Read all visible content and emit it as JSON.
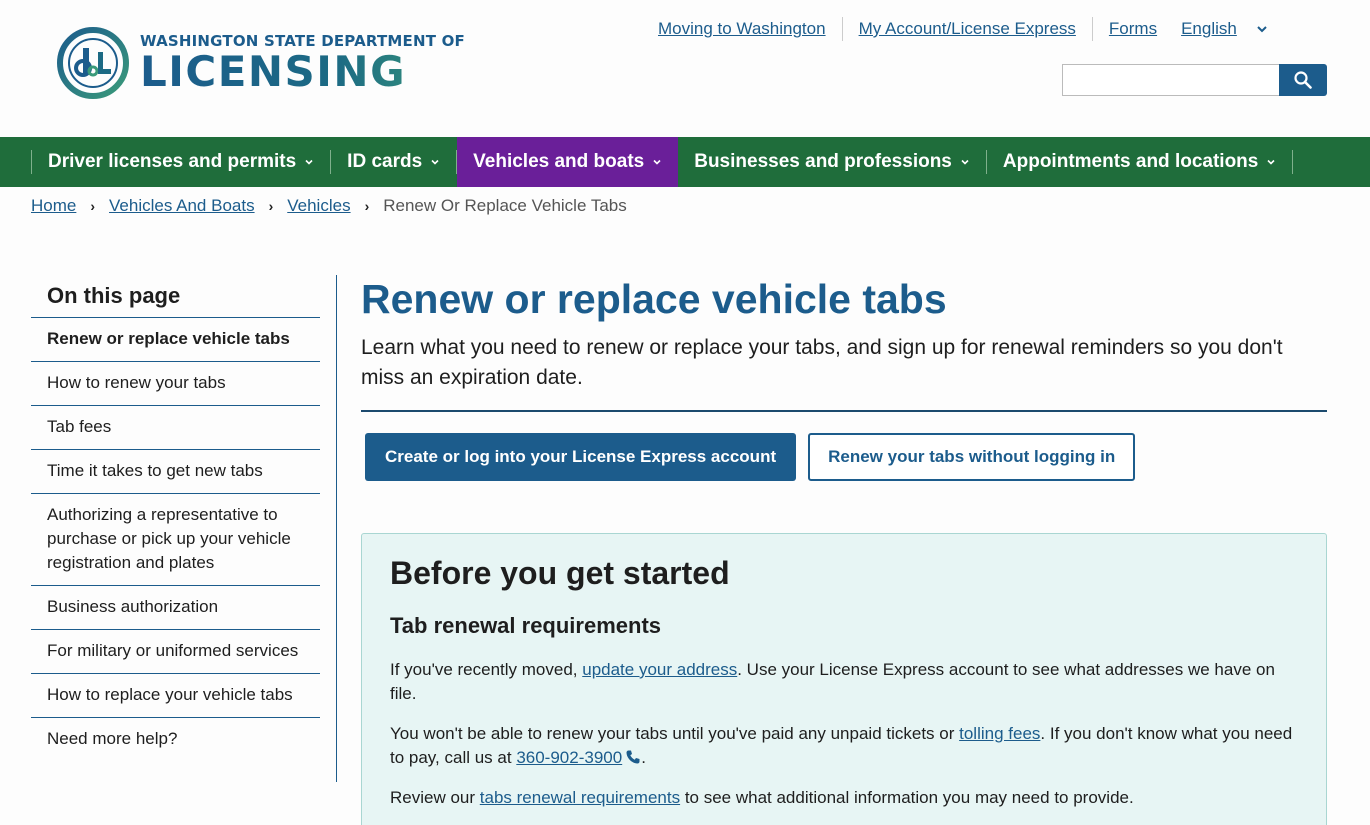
{
  "header": {
    "logo": {
      "line1": "WASHINGTON STATE DEPARTMENT OF",
      "line2": "LICENSING",
      "mark_letters": "dol"
    },
    "utility_links": [
      {
        "label": "Moving to Washington"
      },
      {
        "label": "My Account/License Express"
      },
      {
        "label": "Forms"
      }
    ],
    "language": {
      "selected": "English"
    },
    "search": {
      "placeholder": "",
      "icon": "search-icon"
    }
  },
  "main_nav": {
    "items": [
      {
        "label": "Driver licenses and permits",
        "active": false
      },
      {
        "label": "ID cards",
        "active": false
      },
      {
        "label": "Vehicles and boats",
        "active": true
      },
      {
        "label": "Businesses and professions",
        "active": false
      },
      {
        "label": "Appointments and locations",
        "active": false
      }
    ]
  },
  "breadcrumb": {
    "items": [
      {
        "label": "Home"
      },
      {
        "label": "Vehicles And Boats"
      },
      {
        "label": "Vehicles"
      }
    ],
    "current": "Renew Or Replace Vehicle Tabs"
  },
  "sidebar": {
    "title": "On this page",
    "items": [
      {
        "label": "Renew or replace vehicle tabs",
        "current": true
      },
      {
        "label": "How to renew your tabs"
      },
      {
        "label": "Tab fees"
      },
      {
        "label": "Time it takes to get new tabs"
      },
      {
        "label": "Authorizing a representative to purchase or pick up your vehicle registration and plates"
      },
      {
        "label": "Business authorization"
      },
      {
        "label": "For military or uniformed services"
      },
      {
        "label": "How to replace your vehicle tabs"
      },
      {
        "label": "Need more help?"
      }
    ]
  },
  "main": {
    "title": "Renew or replace vehicle tabs",
    "lead": "Learn what you need to renew or replace your tabs, and sign up for renewal reminders so you don't miss an expiration date.",
    "primary_button": "Create or log into your License Express account",
    "secondary_button": "Renew your tabs without logging in",
    "panel": {
      "heading": "Before you get started",
      "subheading": "Tab renewal requirements",
      "p1": {
        "before": "If you've recently moved, ",
        "link": "update your address",
        "after": ". Use your License Express account to see what addresses we have on file."
      },
      "p2": {
        "before": "You won't be able to renew your tabs until you've paid any unpaid tickets or ",
        "link": "tolling fees",
        "middle": ". If you don't know what you need to pay, call us at ",
        "phone": "360-902-3900",
        "after": "."
      },
      "p3": {
        "before": "Review our ",
        "link": "tabs renewal requirements",
        "after": " to see what additional information you may need to provide."
      }
    }
  },
  "colors": {
    "brand_blue": "#1c5c8c",
    "nav_green": "#1f6d3b",
    "nav_active_purple": "#6a1f99",
    "panel_bg": "#e7f5f4"
  }
}
